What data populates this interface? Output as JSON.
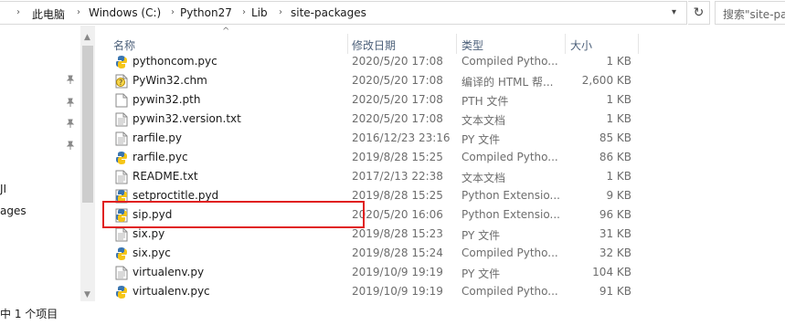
{
  "address": {
    "crumbs": [
      "此电脑",
      "Windows (C:)",
      "Python27",
      "Lib",
      "site-packages"
    ],
    "dropdown_icon": "chevron-down-icon",
    "refresh_icon": "refresh-icon",
    "search_placeholder": "搜索\"site-pa"
  },
  "nav": {
    "labels": [
      "JI",
      "ages"
    ],
    "pins": 4
  },
  "columns": {
    "name": "名称",
    "date": "修改日期",
    "type": "类型",
    "size": "大小"
  },
  "files": [
    {
      "name": "pythoncom.pyc",
      "date": "2020/5/20 17:08",
      "type": "Compiled Pytho...",
      "size": "1 KB",
      "icon": "python-compiled-icon"
    },
    {
      "name": "PyWin32.chm",
      "date": "2020/5/20 17:08",
      "type": "编译的 HTML 帮...",
      "size": "2,600 KB",
      "icon": "help-file-icon"
    },
    {
      "name": "pywin32.pth",
      "date": "2020/5/20 17:08",
      "type": "PTH 文件",
      "size": "1 KB",
      "icon": "file-icon"
    },
    {
      "name": "pywin32.version.txt",
      "date": "2020/5/20 17:08",
      "type": "文本文档",
      "size": "1 KB",
      "icon": "text-file-icon"
    },
    {
      "name": "rarfile.py",
      "date": "2016/12/23 23:16",
      "type": "PY 文件",
      "size": "85 KB",
      "icon": "text-file-icon"
    },
    {
      "name": "rarfile.pyc",
      "date": "2019/8/28 15:25",
      "type": "Compiled Pytho...",
      "size": "86 KB",
      "icon": "python-compiled-icon"
    },
    {
      "name": "README.txt",
      "date": "2017/2/13 22:38",
      "type": "文本文档",
      "size": "1 KB",
      "icon": "text-file-icon"
    },
    {
      "name": "setproctitle.pyd",
      "date": "2019/8/28 15:25",
      "type": "Python Extensio...",
      "size": "9 KB",
      "icon": "python-extension-icon"
    },
    {
      "name": "sip.pyd",
      "date": "2020/5/20 16:06",
      "type": "Python Extensio...",
      "size": "96 KB",
      "icon": "python-extension-icon"
    },
    {
      "name": "six.py",
      "date": "2019/8/28 15:23",
      "type": "PY 文件",
      "size": "31 KB",
      "icon": "text-file-icon"
    },
    {
      "name": "six.pyc",
      "date": "2019/8/28 15:24",
      "type": "Compiled Pytho...",
      "size": "32 KB",
      "icon": "python-compiled-icon"
    },
    {
      "name": "virtualenv.py",
      "date": "2019/10/9 19:19",
      "type": "PY 文件",
      "size": "104 KB",
      "icon": "text-file-icon"
    },
    {
      "name": "virtualenv.pyc",
      "date": "2019/10/9 19:19",
      "type": "Compiled Pytho...",
      "size": "91 KB",
      "icon": "python-compiled-icon"
    }
  ],
  "highlighted_file": "sip.pyd",
  "highlight_color": "#e02020",
  "status": {
    "text": "中 1 个项目"
  }
}
